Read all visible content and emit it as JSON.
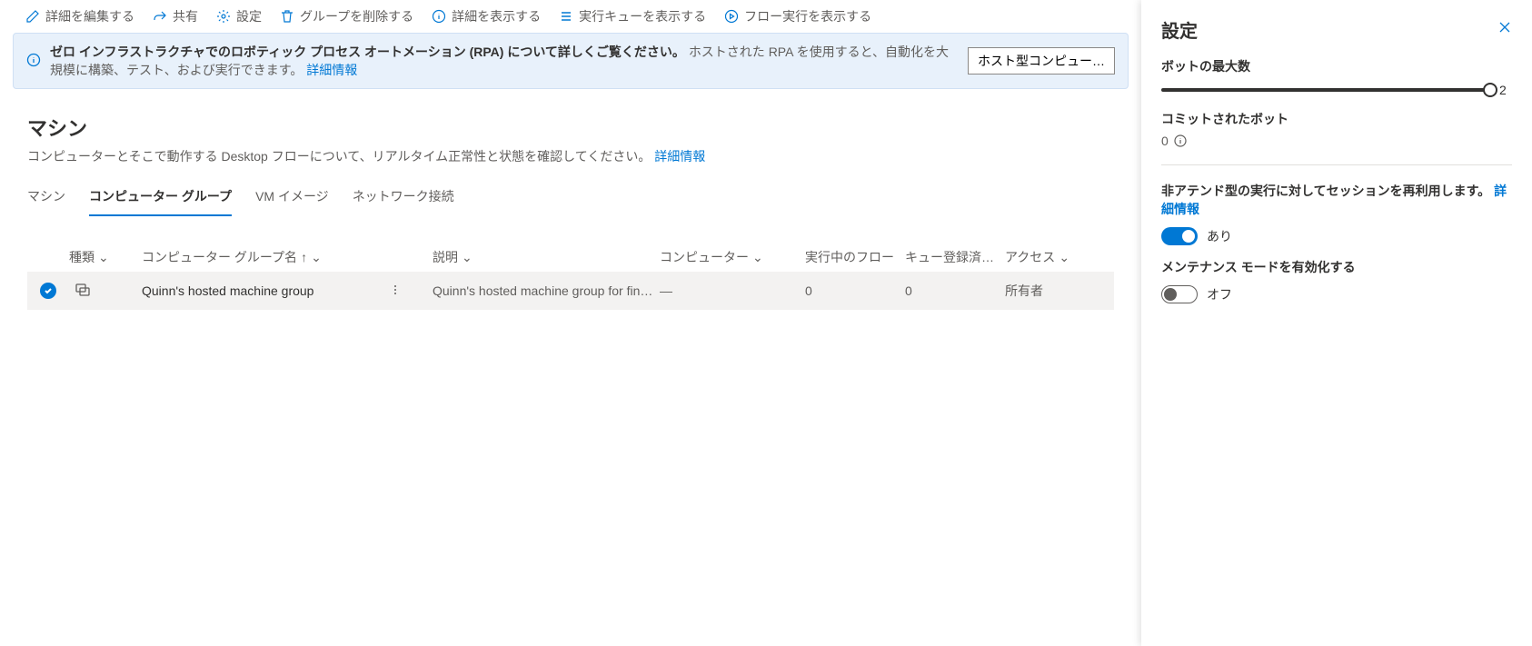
{
  "commandBar": {
    "edit": "詳細を編集する",
    "share": "共有",
    "settings": "設定",
    "delete": "グループを削除する",
    "showDetails": "詳細を表示する",
    "showQueue": "実行キューを表示する",
    "showFlowRuns": "フロー実行を表示する"
  },
  "banner": {
    "bold": "ゼロ インフラストラクチャでのロボティック プロセス オートメーション (RPA) について詳しくご覧ください。",
    "text": "ホストされた RPA を使用すると、自動化を大規模に構築、テスト、および実行できます。",
    "link": "詳細情報",
    "button": "ホスト型コンピュー…"
  },
  "page": {
    "title": "マシン",
    "subtitle": "コンピューターとそこで動作する Desktop フローについて、リアルタイム正常性と状態を確認してください。",
    "subtitleLink": "詳細情報"
  },
  "tabs": {
    "machines": "マシン",
    "groups": "コンピューター グループ",
    "vmImages": "VM イメージ",
    "network": "ネットワーク接続"
  },
  "table": {
    "headers": {
      "type": "種類",
      "name": "コンピューター グループ名",
      "description": "説明",
      "computers": "コンピューター",
      "runningFlows": "実行中のフロー",
      "queued": "キュー登録済…",
      "access": "アクセス"
    },
    "row": {
      "name": "Quinn's hosted machine group",
      "description": "Quinn's hosted machine group for financ…",
      "computers": "—",
      "runningFlows": "0",
      "queued": "0",
      "access": "所有者"
    }
  },
  "panel": {
    "title": "設定",
    "maxBotsLabel": "ボットの最大数",
    "maxBotsValue": "2",
    "committedBotsLabel": "コミットされたボット",
    "committedBotsValue": "0",
    "reuseSessionsLabel": "非アテンド型の実行に対してセッションを再利用します。",
    "reuseSessionsLink": "詳細情報",
    "reuseSessionsToggle": "あり",
    "maintenanceLabel": "メンテナンス モードを有効化する",
    "maintenanceToggle": "オフ"
  }
}
